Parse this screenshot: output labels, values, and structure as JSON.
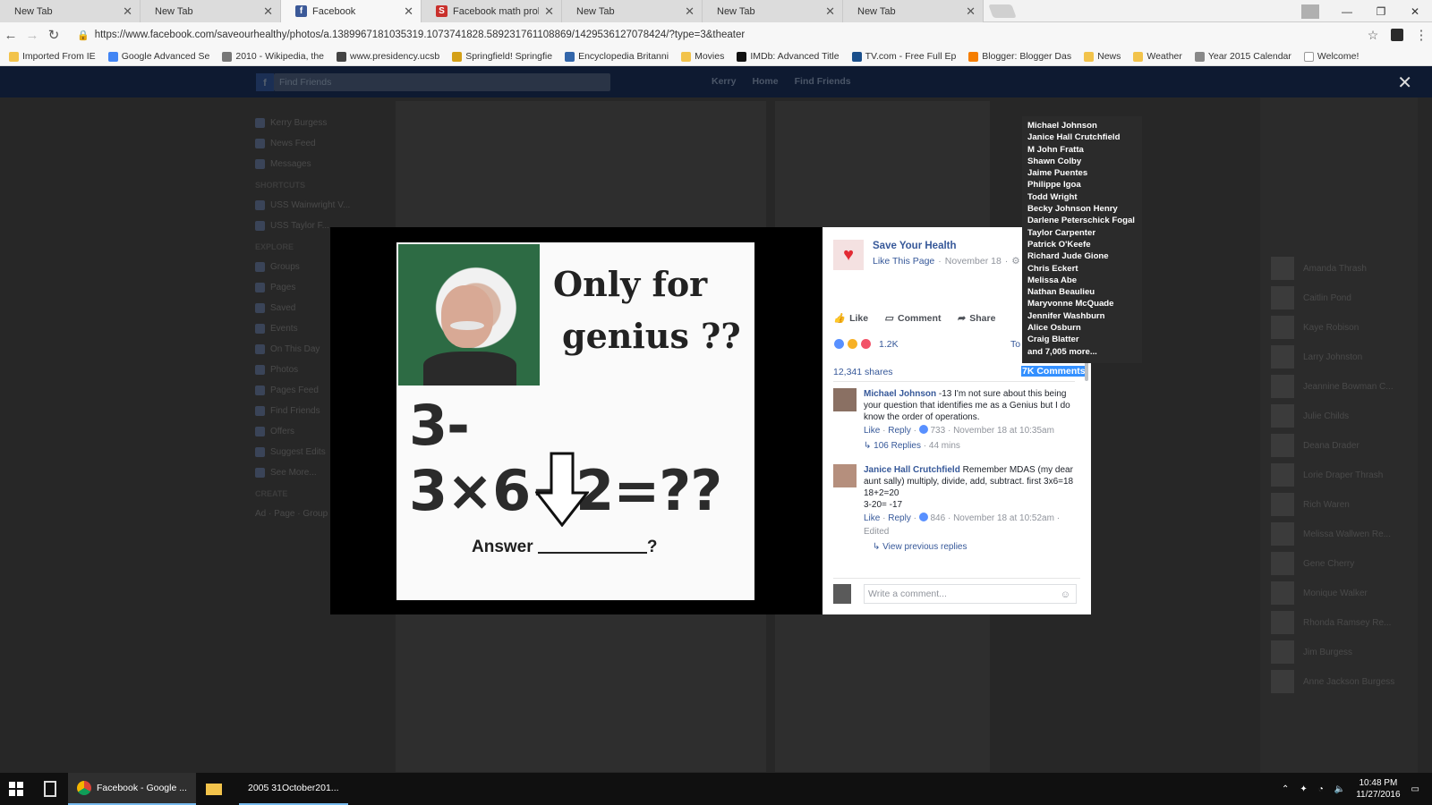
{
  "browser": {
    "tabs": [
      {
        "label": "New Tab",
        "active": false
      },
      {
        "label": "New Tab",
        "active": false
      },
      {
        "label": "Facebook",
        "active": true
      },
      {
        "label": "Facebook math problem",
        "active": false
      },
      {
        "label": "New Tab",
        "active": false
      },
      {
        "label": "New Tab",
        "active": false
      },
      {
        "label": "New Tab",
        "active": false
      }
    ],
    "url": "https://www.facebook.com/saveourhealthy/photos/a.1389967181035319.1073741828.589231761108869/1429536127078424/?type=3&theater",
    "bookmarks": [
      "Imported From IE",
      "Google Advanced Se",
      "2010 - Wikipedia, the",
      "www.presidency.ucsb",
      "Springfield! Springfie",
      "Encyclopedia Britanni",
      "Movies",
      "IMDb: Advanced Title",
      "TV.com - Free Full Ep",
      "Blogger: Blogger Das",
      "News",
      "Weather",
      "Year 2015 Calendar",
      "Welcome!"
    ]
  },
  "facebook": {
    "search_placeholder": "Find Friends",
    "nav": [
      "Kerry",
      "Home",
      "Find Friends"
    ],
    "left_nav": [
      "Kerry Burgess",
      "News Feed",
      "Messages",
      "SHORTCUTS",
      "USS Wainwright V...",
      "USS Taylor F...",
      "EXPLORE",
      "Groups",
      "Pages",
      "Saved",
      "Events",
      "On This Day",
      "Photos",
      "Pages Feed",
      "Find Friends",
      "Offers",
      "Suggest Edits",
      "See More...",
      "CREATE",
      "Ad · Page · Group · Fundraiser"
    ],
    "chat_contacts": [
      "Amanda Thrash",
      "Caitlin Pond",
      "Kaye Robison",
      "Larry Johnston",
      "Jeannine Bowman C...",
      "Julie Childs",
      "Deana Drader",
      "Lorie Draper Thrash",
      "Rich Waren",
      "Melissa Wallwen Re...",
      "Gene Cherry",
      "Monique Walker",
      "Rhonda Ramsey Re...",
      "Jim Burgess",
      "Anne Jackson Burgess"
    ]
  },
  "photo": {
    "line1": "Only for",
    "line2": "genius ??",
    "equation": "3-3×6+2=??",
    "answer_label": "Answer",
    "answer_suffix": "?"
  },
  "post": {
    "page_name": "Save Your Health",
    "like_page": "Like This Page",
    "date": "November 18",
    "actions": {
      "like": "Like",
      "comment": "Comment",
      "share": "Share"
    },
    "reactions_count": "1.2K",
    "top_label": "To",
    "shares": "12,341 shares",
    "comments_link": "7K Comments",
    "write_placeholder": "Write a comment..."
  },
  "comments": [
    {
      "name": "Michael Johnson",
      "text": " -13 I'm not sure about this being your question that identifies me as a Genius but I do know the order of operations.",
      "like": "Like",
      "reply": "Reply",
      "likes": "733",
      "time": "November 18 at 10:35am",
      "replies": "106 Replies",
      "replies_time": "44 mins"
    },
    {
      "name": "Janice Hall Crutchfield",
      "text": " Remember MDAS (my dear aunt sally) multiply, divide, add, subtract. first 3x6=18",
      "lines": [
        "18+2=20",
        "3-20= -17"
      ],
      "like": "Like",
      "reply": "Reply",
      "likes": "846",
      "time": "November 18 at 10:52am",
      "edited": "Edited",
      "view_previous": "View previous replies"
    }
  ],
  "tooltip": [
    "Michael Johnson",
    "Janice Hall Crutchfield",
    "M John Fratta",
    "Shawn Colby",
    "Jaime Puentes",
    "Philippe Igoa",
    "Todd Wright",
    "Becky Johnson Henry",
    "Darlene Peterschick Fogal",
    "Taylor Carpenter",
    "Patrick O'Keefe",
    "Richard Jude Gione",
    "Chris Eckert",
    "Melissa Abe",
    "Nathan Beaulieu",
    "Maryvonne McQuade",
    "Jennifer Washburn",
    "Alice Osburn",
    "Craig Blatter",
    "and 7,005 more..."
  ],
  "taskbar": {
    "apps": [
      "Facebook - Google ...",
      "2005 31October201..."
    ],
    "time": "10:48 PM",
    "date": "11/27/2016"
  },
  "colors": {
    "fb_blue": "#365899",
    "highlight": "#3390ff",
    "love": "#e22a34"
  }
}
